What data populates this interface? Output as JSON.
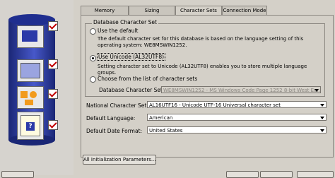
{
  "tabs": [
    "Memory",
    "Sizing",
    "Character Sets",
    "Connection Mode"
  ],
  "database_character_set": {
    "group_title": "Database Character Set",
    "options": {
      "use_default": {
        "label": "Use the default",
        "description": "The default character set for this database is based on the language setting of this operating system: WE8MSWIN1252."
      },
      "use_unicode": {
        "label": "Use Unicode (AL32UTF8)",
        "description": "Setting character set to Unicode (AL32UTF8) enables you to store multiple language groups."
      },
      "choose_list": {
        "label": "Choose from the list of character sets"
      }
    },
    "selected": "use_unicode",
    "field_label": "Database Character Set:",
    "field_value": "WE8MSWIN1252 - MS Windows Code Page 1252 8-bit West Eur..."
  },
  "settings": [
    {
      "label": "National Character Set:",
      "value": "AL16UTF16 - Unicode UTF-16 Universal character set"
    },
    {
      "label": "Default Language:",
      "value": "American"
    },
    {
      "label": "Default Date Format:",
      "value": "United States"
    }
  ],
  "buttons": {
    "all_init_params": "All Initialization Parameters..."
  },
  "colors": {
    "check_red": "#c00000",
    "drum_blue": "#2b3aa8"
  }
}
